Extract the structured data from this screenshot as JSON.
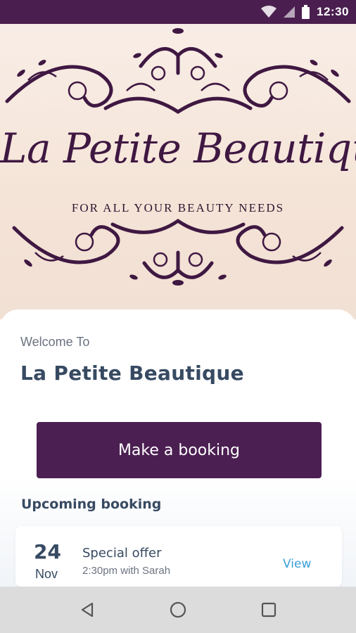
{
  "status_bar": {
    "time": "12:30",
    "icons": [
      "wifi-icon",
      "signal-icon",
      "battery-icon"
    ],
    "background": "#4a1f4f"
  },
  "hero": {
    "title": "La Petite Beautique",
    "tagline": "FOR ALL YOUR BEAUTY NEEDS"
  },
  "welcome": {
    "label": "Welcome To",
    "name": "La Petite Beautique"
  },
  "primary_action": {
    "label": "Make a booking",
    "color": "#4b1f52"
  },
  "upcoming": {
    "heading": "Upcoming booking",
    "booking": {
      "day": "24",
      "month": "Nov",
      "title": "Special offer",
      "detail": "2:30pm with Sarah",
      "action_label": "View"
    }
  },
  "nav_bar": {
    "icons": [
      "back-icon",
      "home-icon",
      "recents-icon"
    ]
  },
  "colors": {
    "accent": "#4b1f52",
    "heading": "#374a62",
    "link": "#3aa0d8"
  }
}
